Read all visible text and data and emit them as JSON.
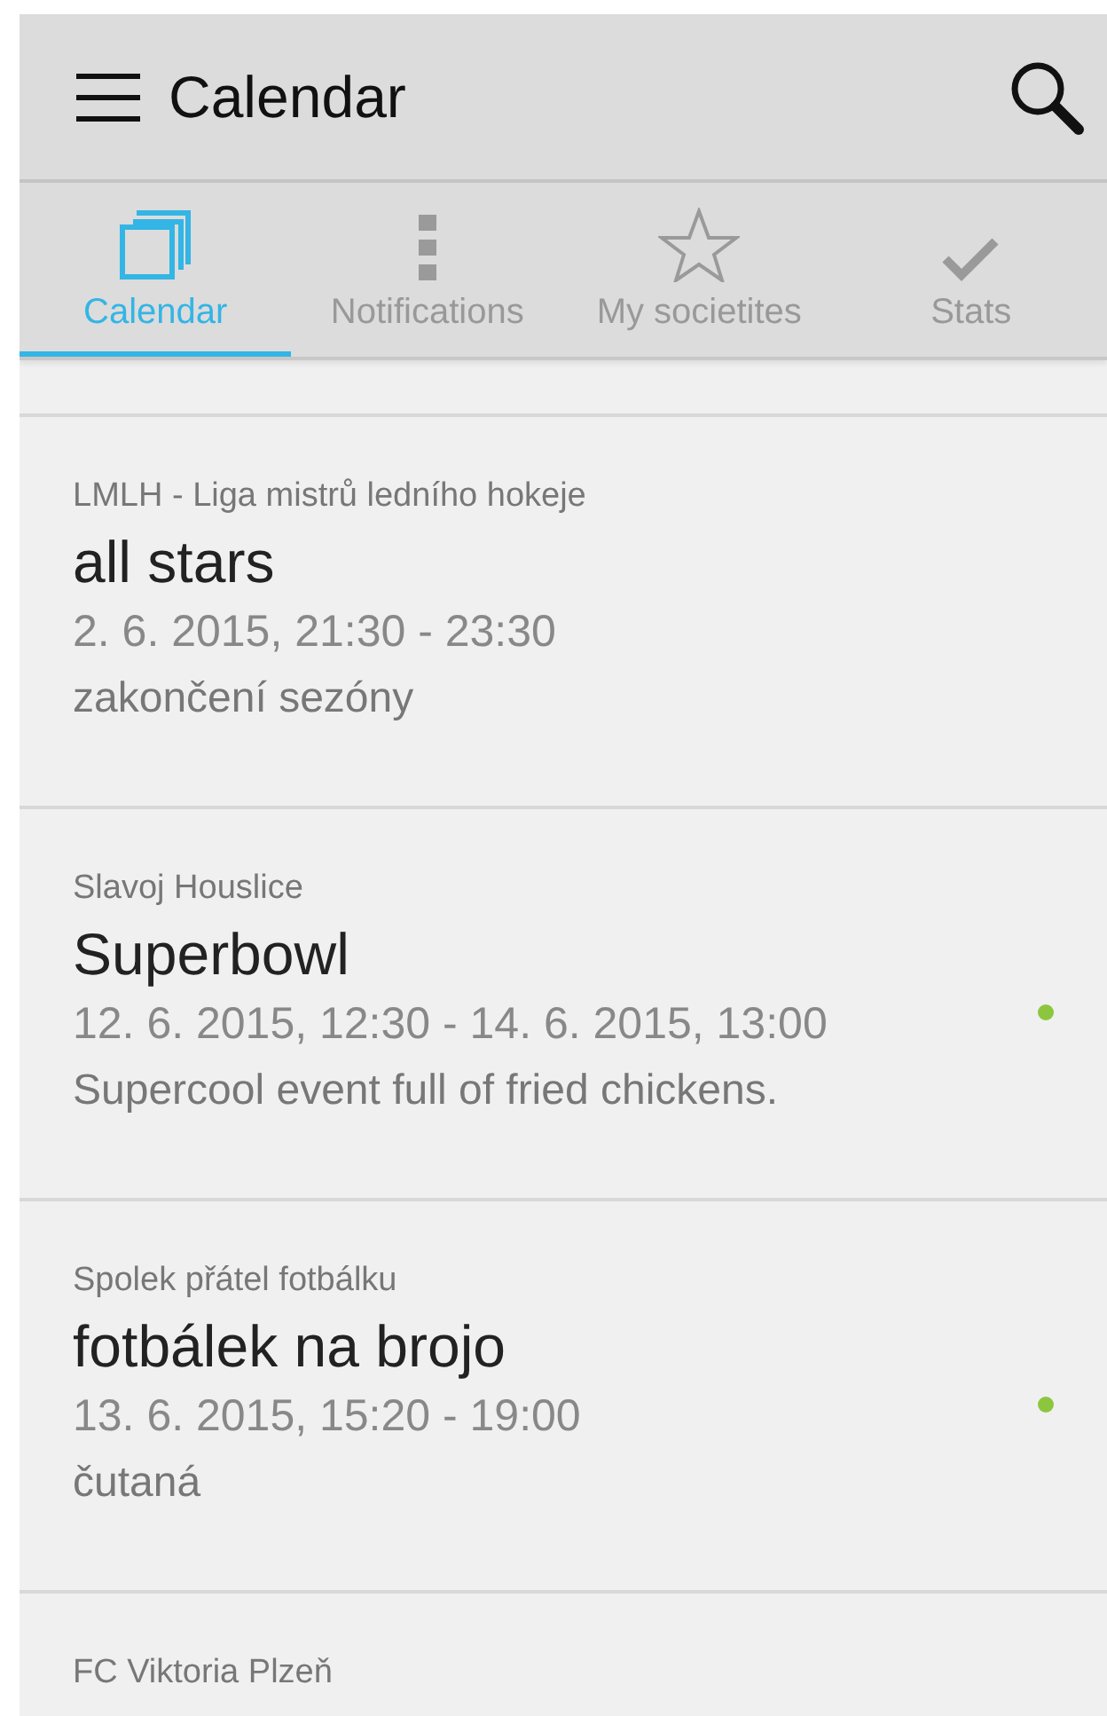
{
  "app_bar": {
    "title": "Calendar"
  },
  "tabs": [
    {
      "label": "Calendar",
      "kind": "pages",
      "selected": true
    },
    {
      "label": "Notifications",
      "kind": "dots",
      "selected": false
    },
    {
      "label": "My societites",
      "kind": "star",
      "selected": false
    },
    {
      "label": "Stats",
      "kind": "check",
      "selected": false
    }
  ],
  "events": [
    {
      "society": "LMLH - Liga mistrů ledního hokeje",
      "title": "all stars",
      "time": "2. 6. 2015, 21:30 - 23:30",
      "description": "zakončení sezóny",
      "indicator": false
    },
    {
      "society": "Slavoj Houslice",
      "title": "Superbowl",
      "time": "12. 6. 2015, 12:30 - 14. 6. 2015, 13:00",
      "description": "Supercool event full of fried chickens.",
      "indicator": true
    },
    {
      "society": "Spolek přátel fotbálku",
      "title": "fotbálek na brojo",
      "time": "13. 6. 2015, 15:20 - 19:00",
      "description": "čutaná",
      "indicator": true
    },
    {
      "society": "FC Viktoria Plzeň",
      "indicator": false
    }
  ]
}
